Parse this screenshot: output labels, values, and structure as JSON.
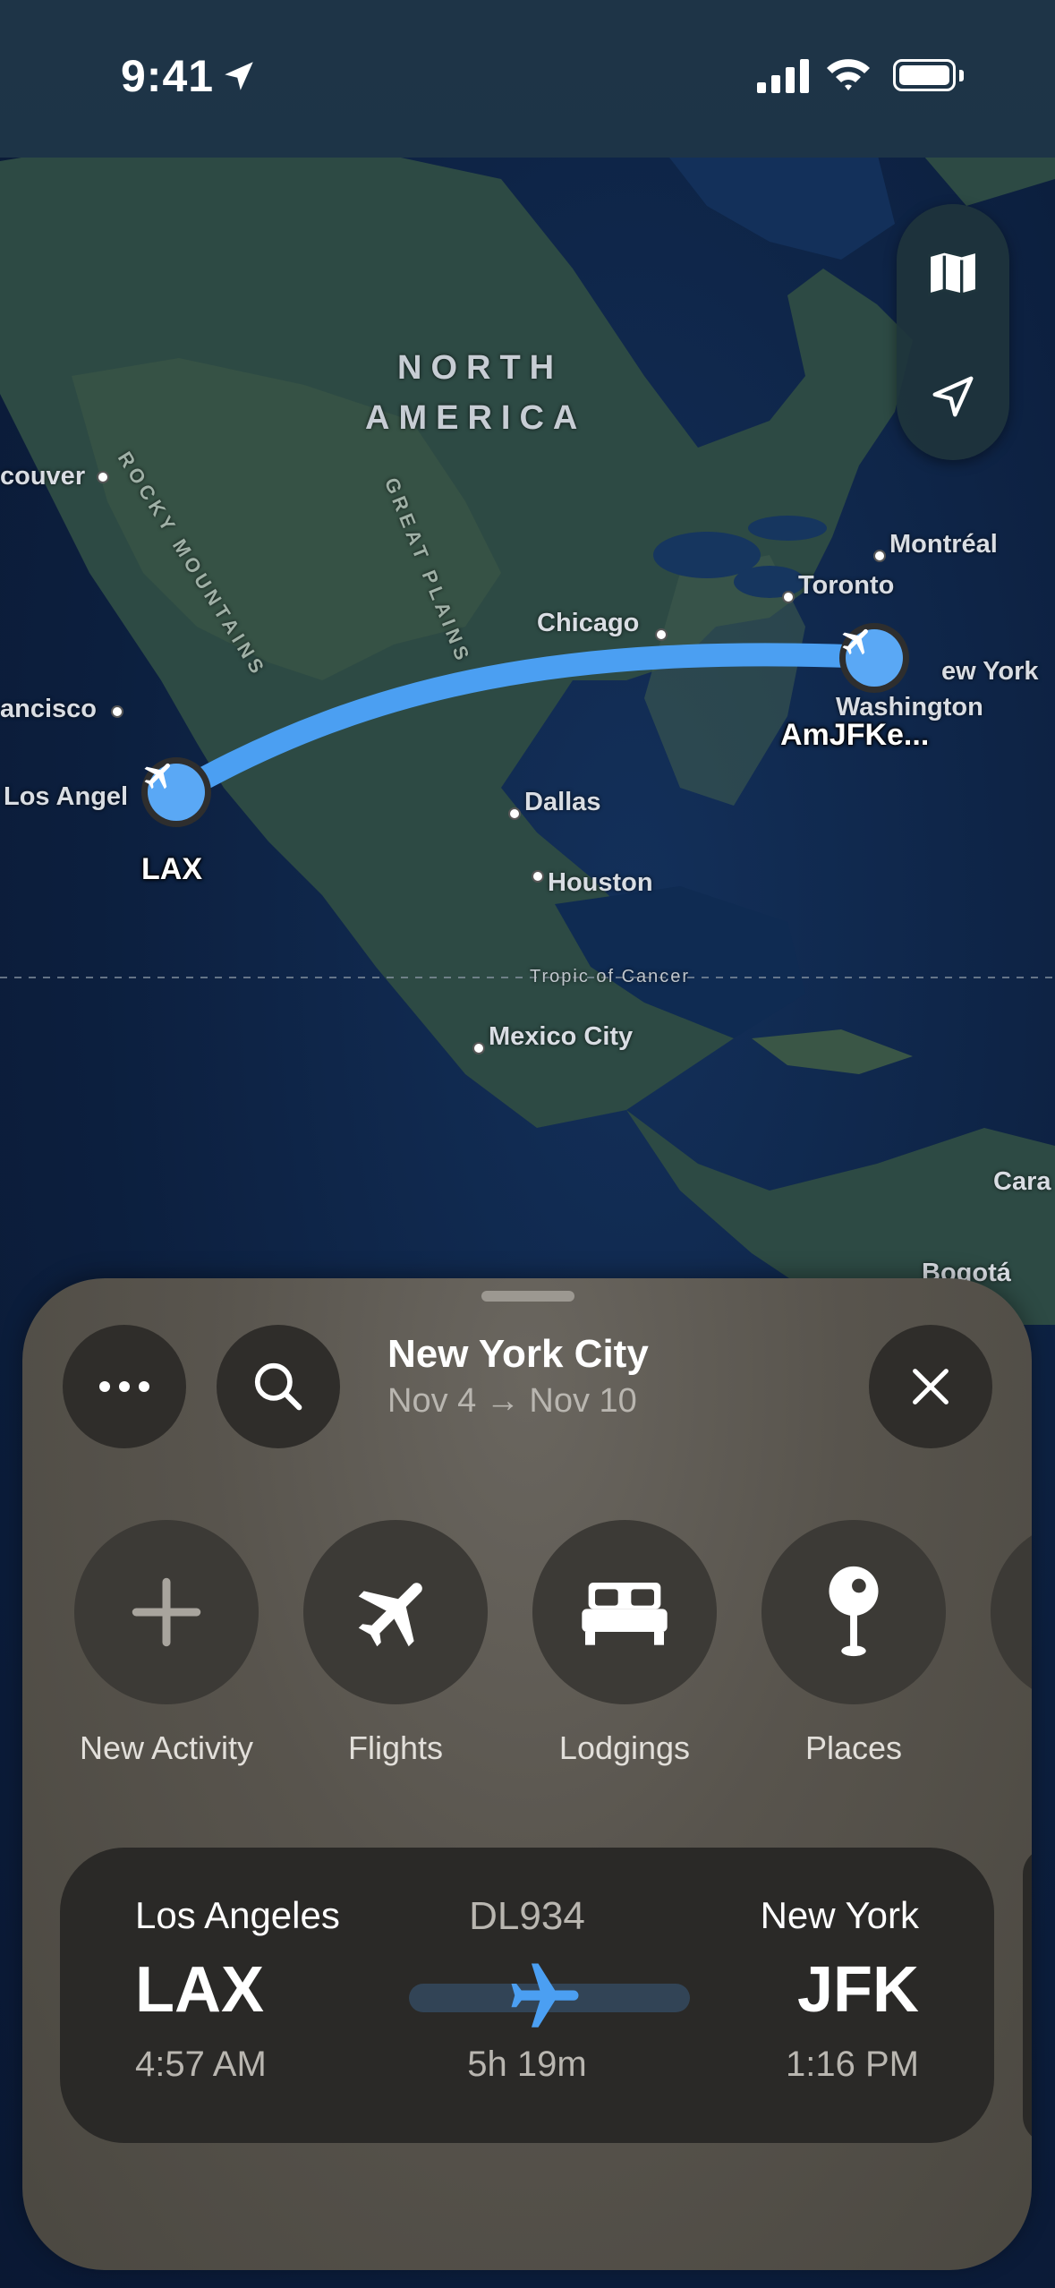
{
  "status_bar": {
    "time": "9:41"
  },
  "map": {
    "region_labels": [
      "NORTH",
      "AMERICA"
    ],
    "features": [
      "ROCKY MOUNTAINS",
      "GREAT PLAINS"
    ],
    "tropic_label": "Tropic of Cancer",
    "cities": {
      "vancouver": "couver",
      "san_francisco": "ancisco",
      "los_angeles": "Los Angel",
      "chicago": "Chicago",
      "dallas": "Dallas",
      "houston": "Houston",
      "mexico_city": "Mexico City",
      "toronto": "Toronto",
      "montreal": "Montréal",
      "new_york": "ew York",
      "washington": "Washington",
      "caracas": "Cara",
      "bogota": "Bogotá"
    },
    "pins": {
      "origin": "LAX",
      "destination": "AmJFKe..."
    },
    "route_color": "#4b9ff2"
  },
  "map_controls": {
    "map_mode_icon": "map-icon",
    "locate_icon": "location-arrow-icon"
  },
  "sheet": {
    "title": "New York City",
    "dates": "Nov 4 → Nov 10",
    "more_icon": "ellipsis-icon",
    "search_icon": "search-icon",
    "close_icon": "close-icon",
    "actions": [
      {
        "label": "New Activity",
        "icon": "plus-icon"
      },
      {
        "label": "Flights",
        "icon": "airplane-icon"
      },
      {
        "label": "Lodgings",
        "icon": "bed-icon"
      },
      {
        "label": "Places",
        "icon": "pin-icon"
      }
    ],
    "flight": {
      "origin_city": "Los Angeles",
      "origin_code": "LAX",
      "departure_time": "4:57 AM",
      "flight_number": "DL934",
      "duration": "5h 19m",
      "destination_city": "New York",
      "destination_code": "JFK",
      "arrival_time": "1:16 PM",
      "progress": 0.42
    }
  }
}
